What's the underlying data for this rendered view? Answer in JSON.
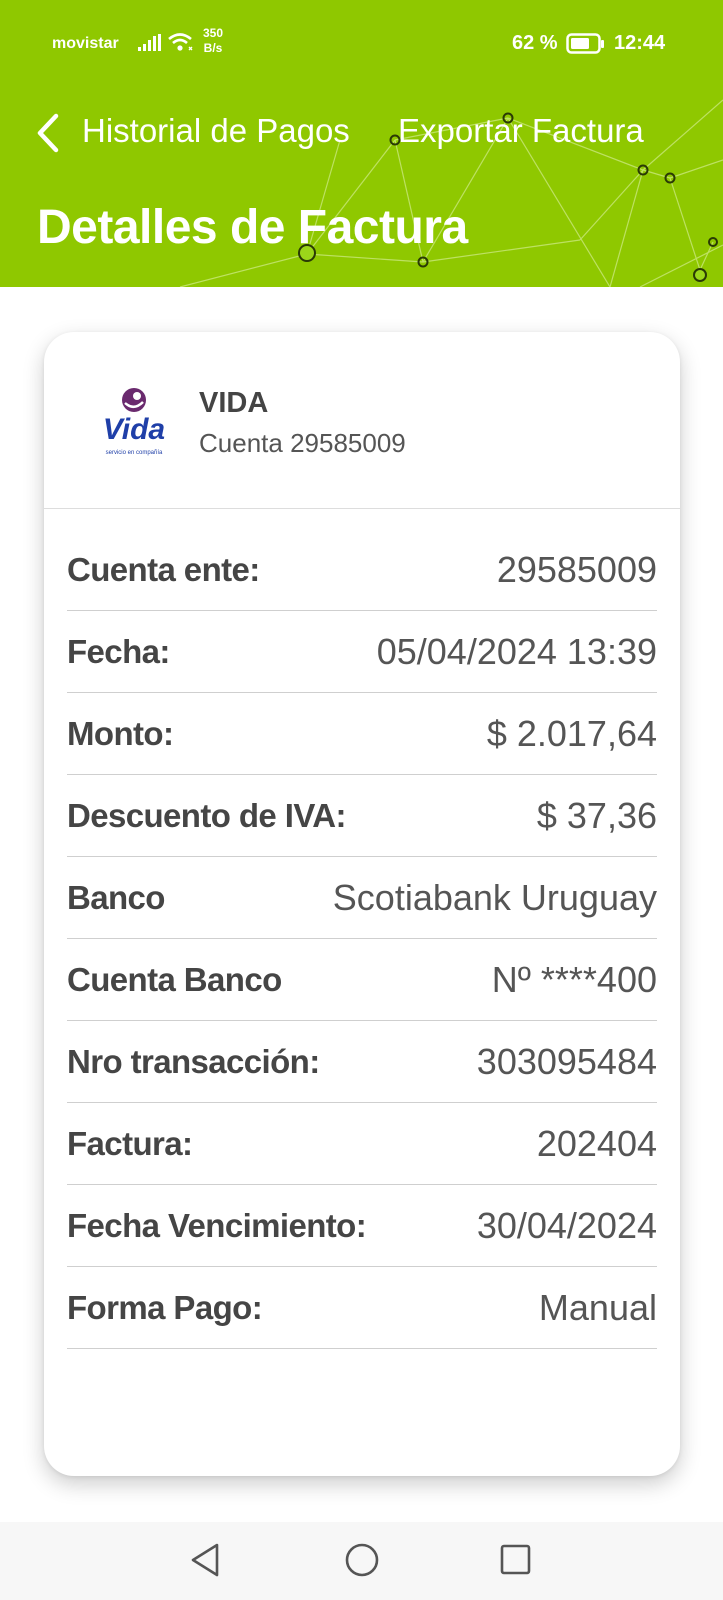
{
  "status_bar": {
    "carrier": "movistar",
    "net_speed_value": "350",
    "net_speed_unit": "B/s",
    "battery": "62 %",
    "time": "12:44"
  },
  "nav": {
    "back_label": "Historial de Pagos",
    "export_label": "Exportar Factura"
  },
  "page": {
    "title": "Detalles de Factura"
  },
  "company": {
    "name": "VIDA",
    "account": "Cuenta 29585009",
    "logo_text": "Vida",
    "logo_tagline": "servicio en compañía"
  },
  "details": [
    {
      "label": "Cuenta ente:",
      "value": "29585009"
    },
    {
      "label": "Fecha:",
      "value": "05/04/2024 13:39"
    },
    {
      "label": "Monto:",
      "value": "$ 2.017,64"
    },
    {
      "label": "Descuento de IVA:",
      "value": "$ 37,36"
    },
    {
      "label": "Banco",
      "value": "Scotiabank Uruguay"
    },
    {
      "label": "Cuenta Banco",
      "value": "Nº ****400"
    },
    {
      "label": "Nro transacción:",
      "value": "303095484"
    },
    {
      "label": "Factura:",
      "value": "202404"
    },
    {
      "label": "Fecha Vencimiento:",
      "value": "30/04/2024"
    },
    {
      "label": "Forma Pago:",
      "value": "Manual"
    }
  ],
  "colors": {
    "header_green": "#8fc800",
    "logo_purple": "#6a2a6e",
    "logo_blue": "#1f3fa8"
  },
  "icons": {
    "back": "chevron-left-icon",
    "signal": "signal-icon",
    "wifi": "wifi-icon",
    "battery": "battery-icon",
    "nav_back": "triangle-back-icon",
    "nav_home": "circle-home-icon",
    "nav_recents": "square-recents-icon"
  }
}
